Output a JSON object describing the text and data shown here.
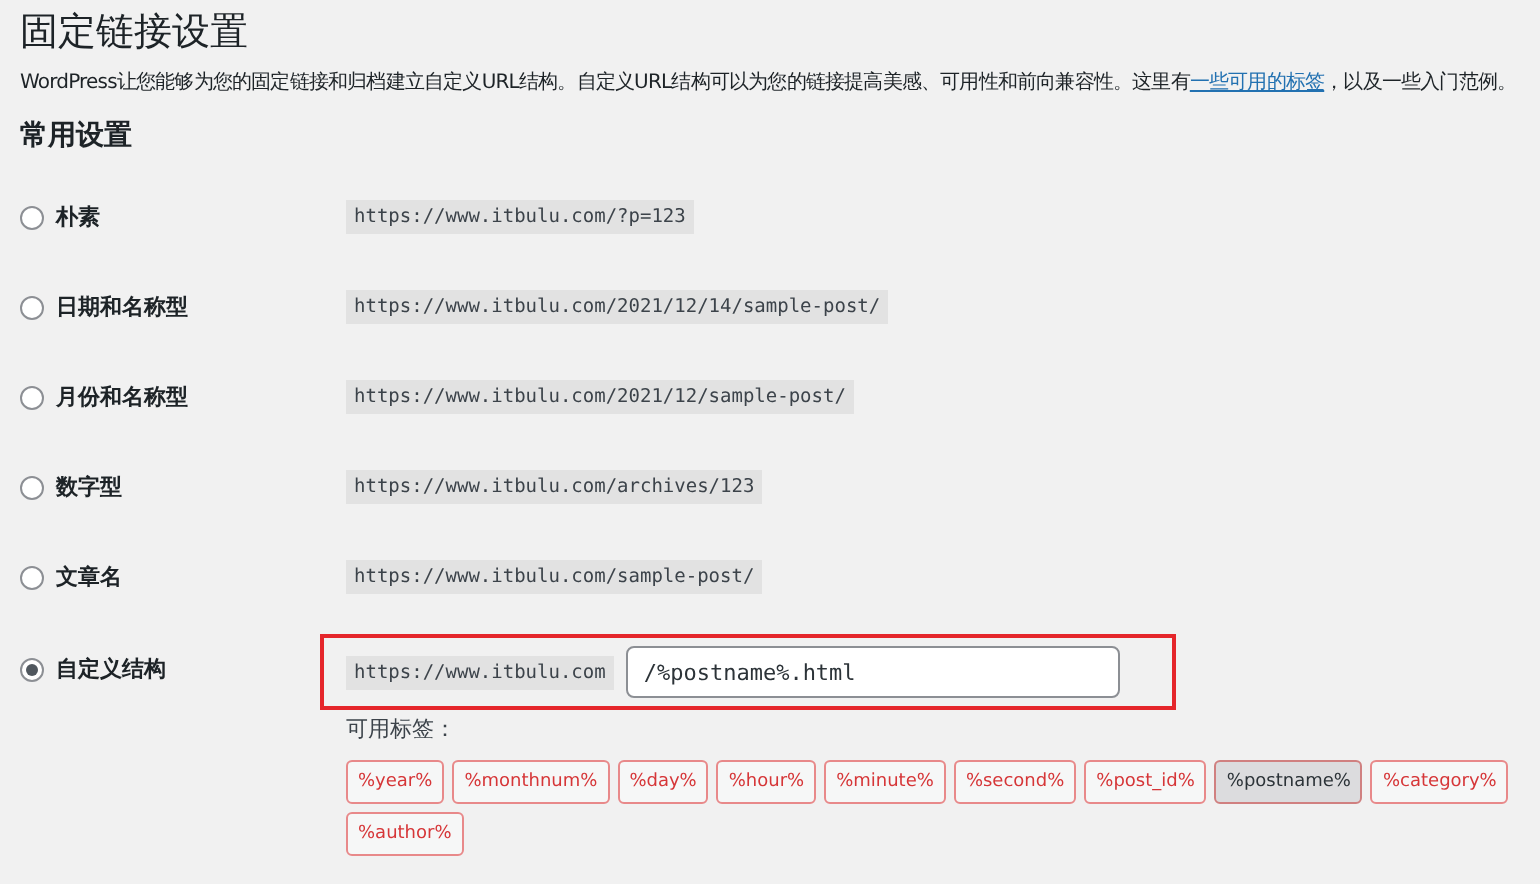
{
  "title": "固定链接设置",
  "description": {
    "before": "WordPress让您能够为您的固定链接和归档建立自定义URL结构。自定义URL结构可以为您的链接提高美感、可用性和前向兼容性。这里有",
    "link": "一些可用的标签",
    "after": "，以及一些入门范例。"
  },
  "section_title": "常用设置",
  "options": [
    {
      "label": "朴素",
      "example": "https://www.itbulu.com/?p=123",
      "selected": false,
      "kind": "preset"
    },
    {
      "label": "日期和名称型",
      "example": "https://www.itbulu.com/2021/12/14/sample-post/",
      "selected": false,
      "kind": "preset"
    },
    {
      "label": "月份和名称型",
      "example": "https://www.itbulu.com/2021/12/sample-post/",
      "selected": false,
      "kind": "preset"
    },
    {
      "label": "数字型",
      "example": "https://www.itbulu.com/archives/123",
      "selected": false,
      "kind": "preset"
    },
    {
      "label": "文章名",
      "example": "https://www.itbulu.com/sample-post/",
      "selected": false,
      "kind": "preset"
    },
    {
      "label": "自定义结构",
      "example": "https://www.itbulu.com",
      "value": "/%postname%.html",
      "selected": true,
      "kind": "custom"
    }
  ],
  "tags_label": "可用标签：",
  "tags": [
    {
      "label": "%year%",
      "selected": false
    },
    {
      "label": "%monthnum%",
      "selected": false
    },
    {
      "label": "%day%",
      "selected": false
    },
    {
      "label": "%hour%",
      "selected": false
    },
    {
      "label": "%minute%",
      "selected": false
    },
    {
      "label": "%second%",
      "selected": false
    },
    {
      "label": "%post_id%",
      "selected": false
    },
    {
      "label": "%postname%",
      "selected": true
    },
    {
      "label": "%category%",
      "selected": false
    },
    {
      "label": "%author%",
      "selected": false
    }
  ]
}
